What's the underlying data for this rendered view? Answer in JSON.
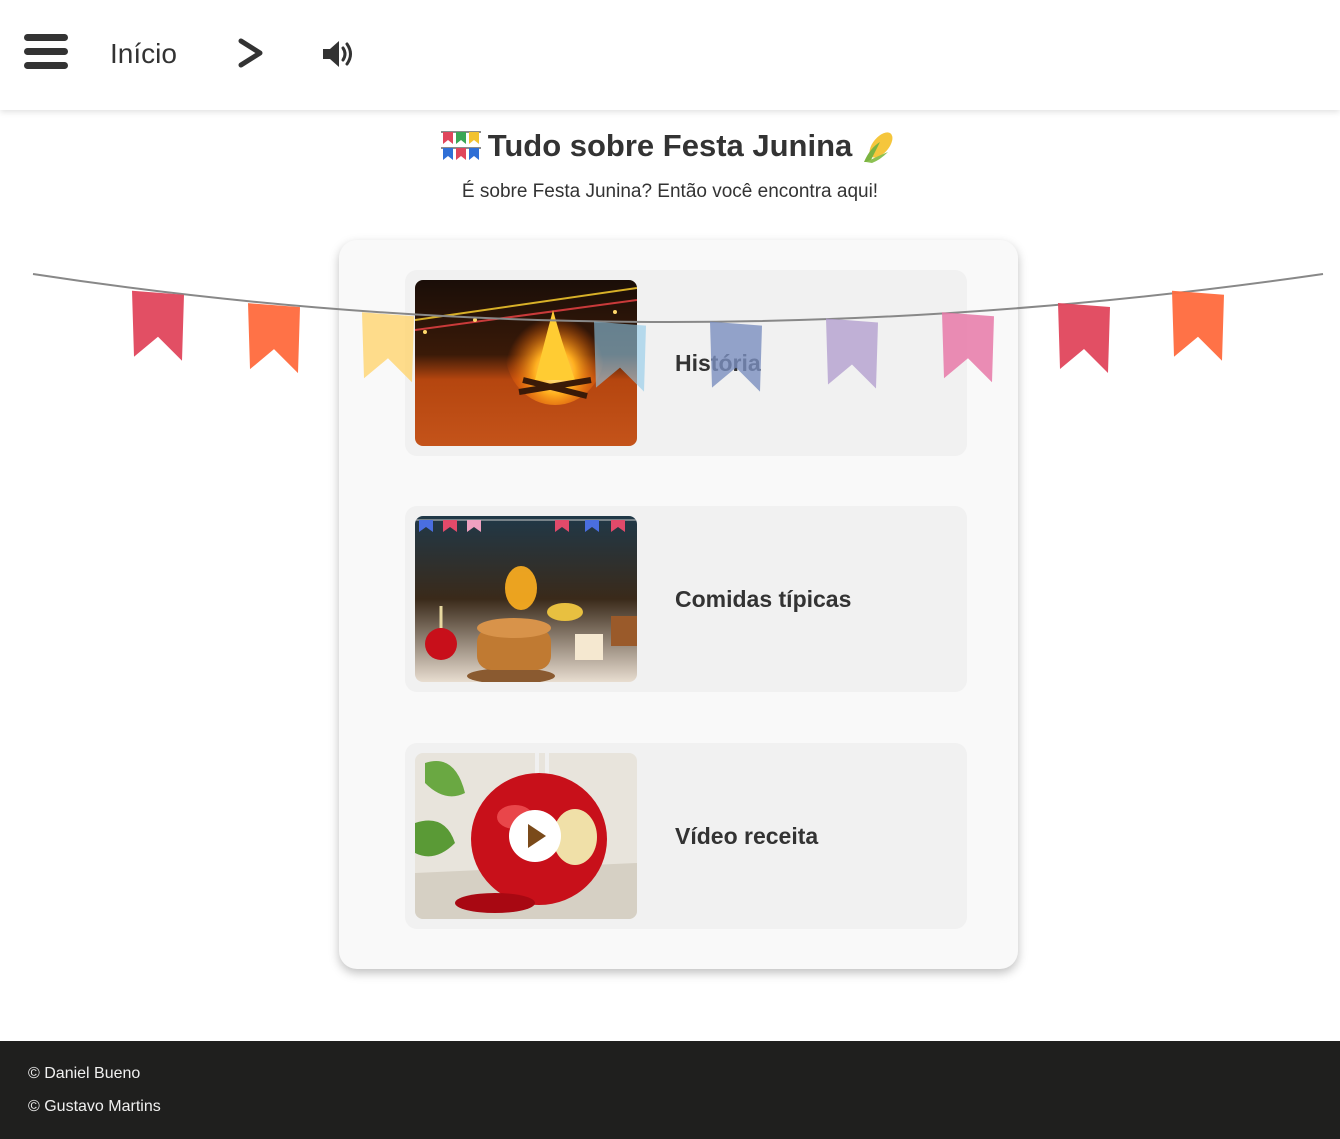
{
  "header": {
    "menu_icon": "hamburger-menu-icon",
    "home_label": "Início",
    "next_icon": "chevron-right-icon",
    "audio_icon": "speaker-volume-icon"
  },
  "page": {
    "title": "Tudo sobre Festa Junina",
    "title_left_icon": "bunting-flags-emoji",
    "title_right_icon": "corn-emoji",
    "subtitle": "É sobre Festa Junina? Então você encontra aqui!"
  },
  "items": [
    {
      "label": "História",
      "image": "bonfire-festa-junina-photo"
    },
    {
      "label": "Comidas típicas",
      "image": "festa-junina-food-table-photo"
    },
    {
      "label": "Vídeo receita",
      "image": "candy-apple-video-thumbnail"
    }
  ],
  "footer": {
    "credits": [
      "© Daniel Bueno",
      "© Gustavo Martins"
    ]
  },
  "colors": {
    "text": "#333333",
    "footer_bg": "#1f1f1e",
    "card_bg": "#f9f9f9",
    "item_bg": "#f1f1f1",
    "bunting": [
      "#e0465c",
      "#ff6a3d",
      "#ffd166",
      "#8ec9ea",
      "#7a8fbf",
      "#b4a0d0",
      "#e879a8",
      "#e0465c",
      "#ff6a3d"
    ]
  }
}
